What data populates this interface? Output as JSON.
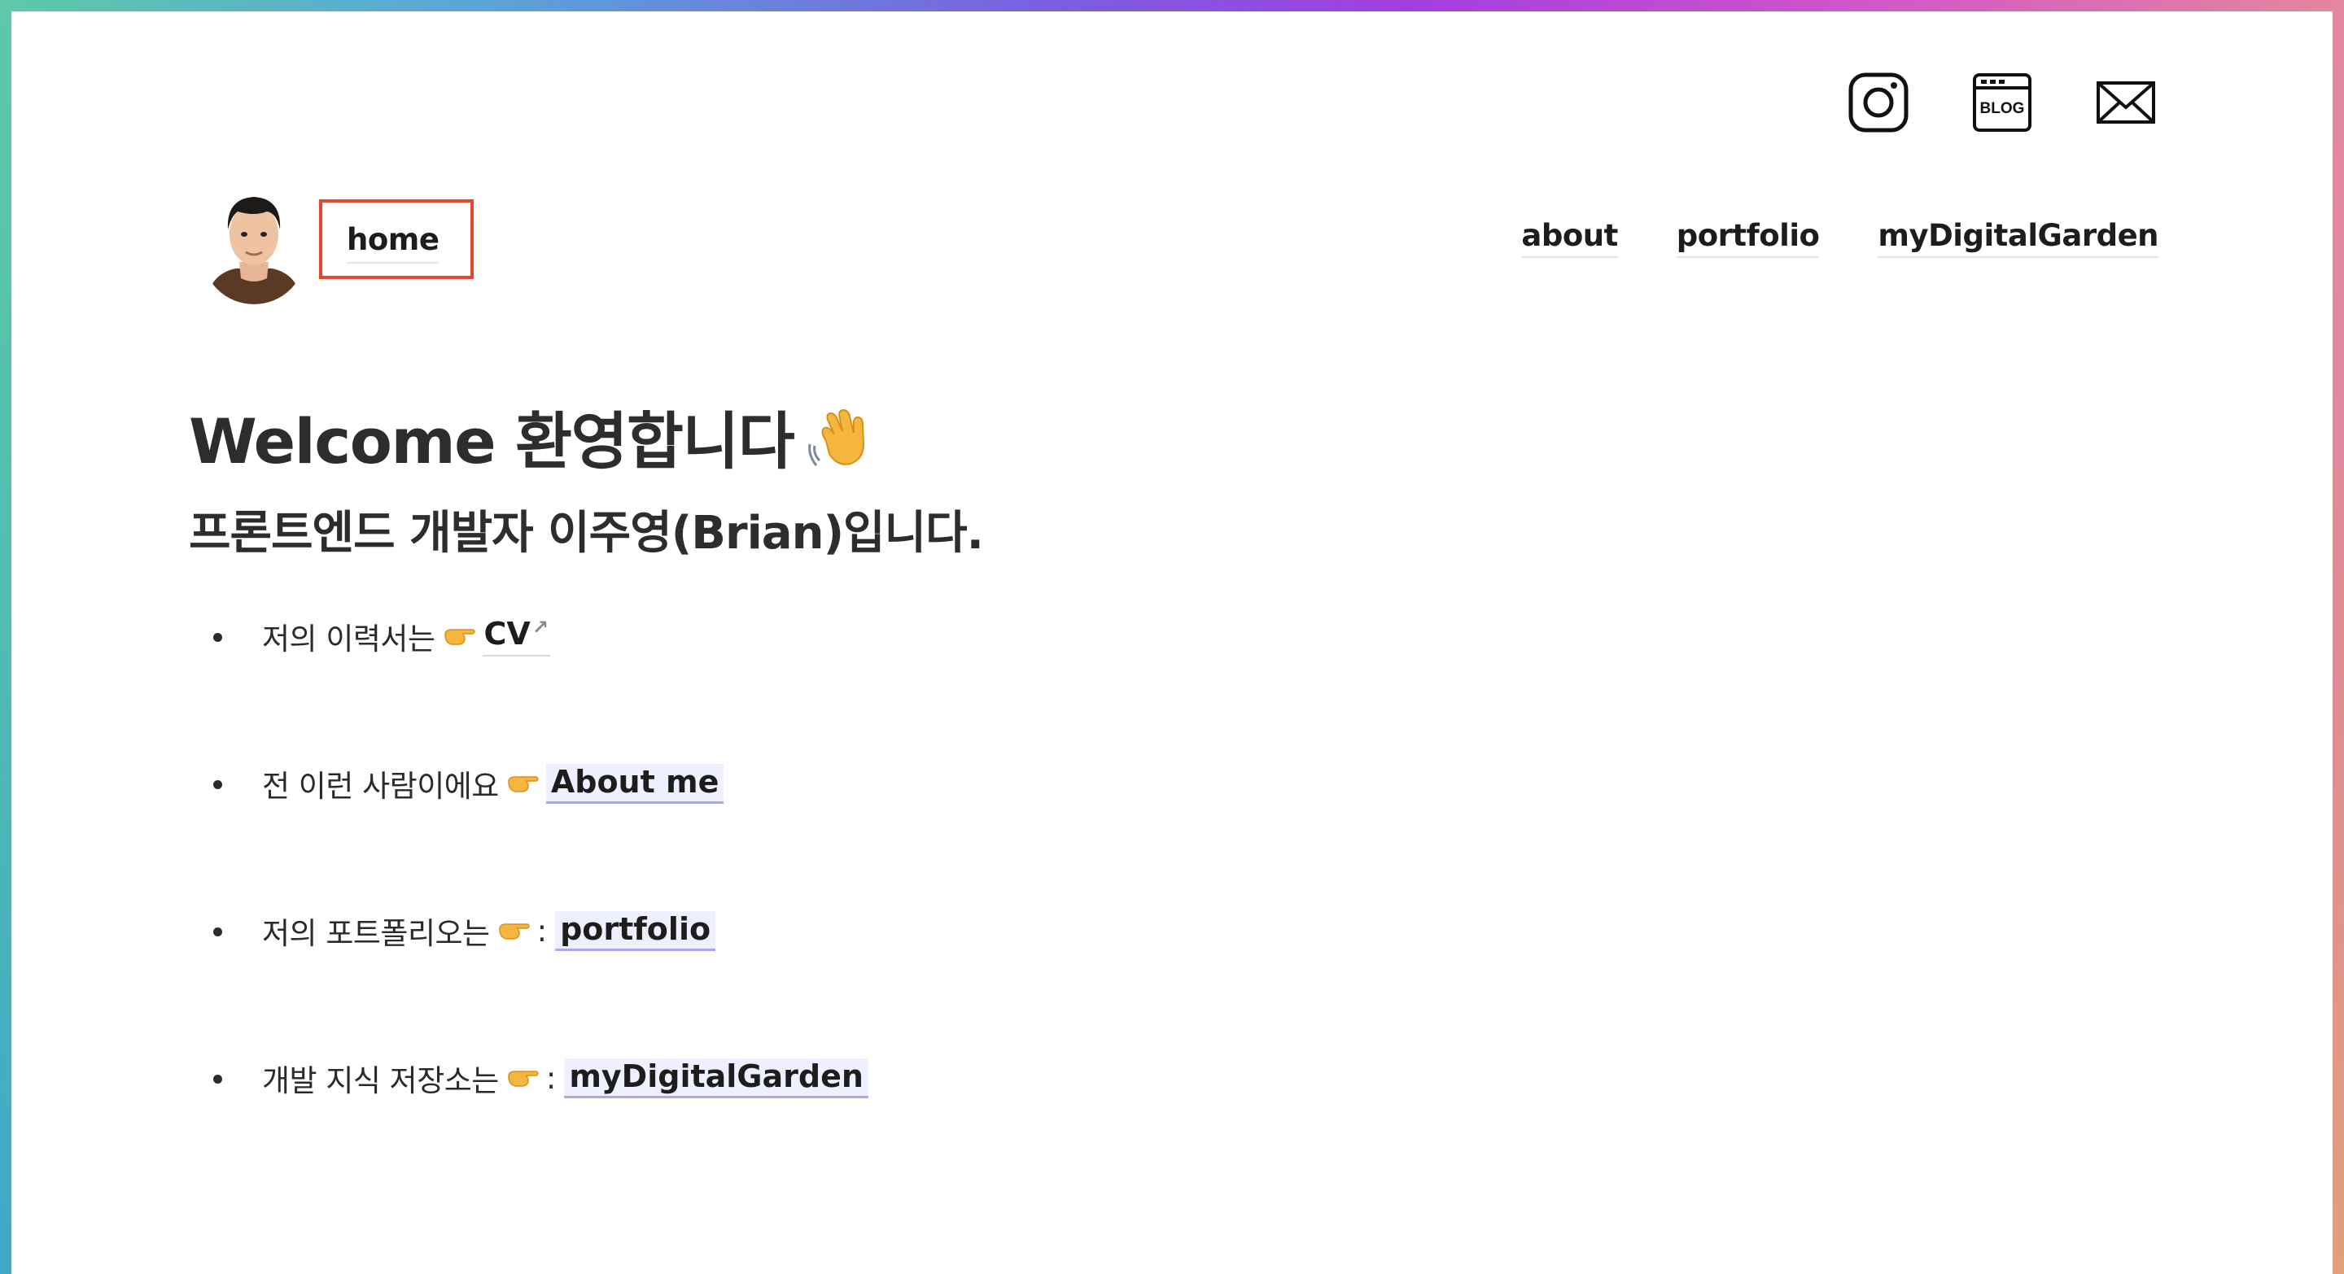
{
  "social": [
    {
      "name": "instagram-icon",
      "label": "instagram"
    },
    {
      "name": "blog-icon",
      "label": "BLOG"
    },
    {
      "name": "mail-icon",
      "label": "mail"
    }
  ],
  "header": {
    "home": "home",
    "nav": [
      "about",
      "portfolio",
      "myDigitalGarden"
    ]
  },
  "main": {
    "title": "Welcome 환영합니다",
    "subtitle": "프론트엔드 개발자 이주영(Brian)입니다.",
    "items": [
      {
        "text": "저의 이력서는",
        "colon": "",
        "link": "CV"
      },
      {
        "text": "전 이런 사람이에요",
        "colon": "",
        "link": "About me"
      },
      {
        "text": "저의 포트폴리오는",
        "colon": ":",
        "link": "portfolio"
      },
      {
        "text": "개발 지식 저장소는",
        "colon": ":",
        "link": "myDigitalGarden"
      }
    ]
  },
  "colors": {
    "highlight_box": "#e2482e",
    "link_underline": "#a9a7ee",
    "link_bg": "#eef0ff"
  }
}
